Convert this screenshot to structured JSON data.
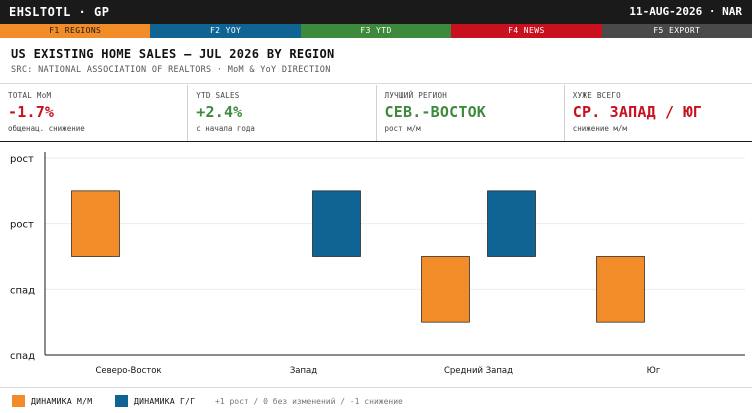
{
  "topbar": {
    "ticker": "EHSLTOTL · GP",
    "date": "11-AUG-2026 · NAR"
  },
  "fkeys": [
    "F1 REGIONS",
    "F2 YOY",
    "F3 YTD",
    "F4 NEWS",
    "F5 EXPORT"
  ],
  "header": {
    "title": "US EXISTING HOME SALES — JUL 2026 BY REGION",
    "subtitle": "SRC: NATIONAL ASSOCIATION OF REALTORS · MoM & YoY DIRECTION"
  },
  "metrics": [
    {
      "label": "TOTAL MoM",
      "value": "-1.7%",
      "sub": "общенац. снижение",
      "tone": "neg"
    },
    {
      "label": "YTD SALES",
      "value": "+2.4%",
      "sub": "с начала года",
      "tone": "pos"
    },
    {
      "label": "ЛУЧШИЙ РЕГИОН",
      "value": "СЕВ.-ВОСТОК",
      "sub": "рост м/м",
      "tone": "pos"
    },
    {
      "label": "ХУЖЕ ВСЕГО",
      "value": "СР. ЗАПАД / ЮГ",
      "sub": "снижение м/м",
      "tone": "neg"
    }
  ],
  "chart_data": {
    "type": "bar",
    "categories": [
      "Северо-Восток",
      "Запад",
      "Средний Запад",
      "Юг"
    ],
    "series": [
      {
        "name": "ДИНАМИКА М/М",
        "color": "#f28c28",
        "values": [
          1,
          0,
          -1,
          -1
        ]
      },
      {
        "name": "ДИНАМИКА Г/Г",
        "color": "#0f6494",
        "values": [
          0,
          1,
          1,
          0
        ]
      }
    ],
    "ylim": [
      -1.5,
      1.5
    ],
    "yticks": [
      {
        "value": 1.5,
        "label": "рост"
      },
      {
        "value": 0.5,
        "label": "рост"
      },
      {
        "value": -0.5,
        "label": "спад"
      },
      {
        "value": -1.5,
        "label": "спад"
      }
    ],
    "grid": true
  },
  "legend": {
    "mom_label": "ДИНАМИКА М/М",
    "yoy_label": "ДИНАМИКА Г/Г",
    "note": "+1 рост / 0 без изменений / -1 снижение"
  }
}
